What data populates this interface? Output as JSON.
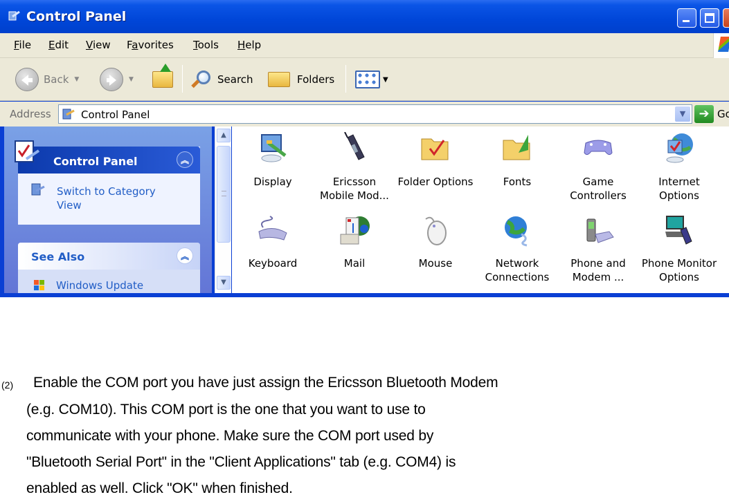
{
  "window": {
    "title": "Control Panel",
    "controls": [
      "minimize",
      "maximize",
      "close"
    ]
  },
  "menubar": {
    "items": [
      {
        "label": "File",
        "accel": "F",
        "rest": "ile"
      },
      {
        "label": "Edit",
        "accel": "E",
        "rest": "dit"
      },
      {
        "label": "View",
        "accel": "V",
        "rest": "iew"
      },
      {
        "label": "Favorites",
        "pre": "F",
        "accel": "a",
        "rest": "vorites"
      },
      {
        "label": "Tools",
        "accel": "T",
        "rest": "ools"
      },
      {
        "label": "Help",
        "accel": "H",
        "rest": "elp"
      }
    ]
  },
  "toolbar": {
    "back_label": "Back",
    "search_label": "Search",
    "folders_label": "Folders"
  },
  "addressbar": {
    "label": "Address",
    "value": "Control Panel",
    "go_label": "Go"
  },
  "taskpane": {
    "control_panel": {
      "title": "Control Panel",
      "link_line1": "Switch to Category",
      "link_line2": "View"
    },
    "see_also": {
      "title": "See Also",
      "links": [
        "Windows Update"
      ]
    }
  },
  "icons": [
    {
      "line1": "Display",
      "line2": "",
      "icon": "display-icon"
    },
    {
      "line1": "Ericsson",
      "line2": "Mobile Mod...",
      "icon": "mobile-phone-icon"
    },
    {
      "line1": "Folder Options",
      "line2": "",
      "icon": "folder-options-icon"
    },
    {
      "line1": "Fonts",
      "line2": "",
      "icon": "fonts-folder-icon"
    },
    {
      "line1": "Game",
      "line2": "Controllers",
      "icon": "gamepad-icon"
    },
    {
      "line1": "Internet",
      "line2": "Options",
      "icon": "internet-options-icon"
    },
    {
      "line1": "Keyboard",
      "line2": "",
      "icon": "keyboard-icon"
    },
    {
      "line1": "Mail",
      "line2": "",
      "icon": "mail-icon"
    },
    {
      "line1": "Mouse",
      "line2": "",
      "icon": "mouse-icon"
    },
    {
      "line1": "Network",
      "line2": "Connections",
      "icon": "network-globe-icon"
    },
    {
      "line1": "Phone and",
      "line2": "Modem ...",
      "icon": "phone-modem-icon"
    },
    {
      "line1": "Phone Monitor",
      "line2": "Options",
      "icon": "phone-monitor-icon"
    }
  ],
  "instructions": {
    "step_number": "(2)",
    "lines": [
      "Enable the COM port you have just assign the Ericsson Bluetooth Modem",
      "(e.g. COM10). This COM port is the one that you want to use to",
      "communicate with your phone. Make sure the COM port used by",
      "\"Bluetooth Serial Port\" in the \"Client Applications\" tab (e.g. COM4) is",
      "enabled as well. Click \"OK\" when finished."
    ]
  },
  "colors": {
    "titlebar": "#0046d8",
    "taskpane_bg": "#7aa1e6",
    "link": "#215dc6",
    "chrome": "#ece9d8"
  }
}
